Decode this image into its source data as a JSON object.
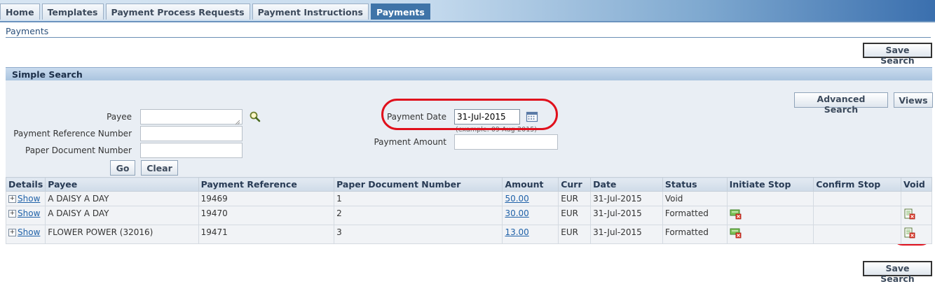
{
  "tabs": [
    {
      "label": "Home",
      "active": false
    },
    {
      "label": "Templates",
      "active": false
    },
    {
      "label": "Payment Process Requests",
      "active": false
    },
    {
      "label": "Payment Instructions",
      "active": false
    },
    {
      "label": "Payments",
      "active": true
    }
  ],
  "page": {
    "title": "Payments",
    "save_search_label": "Save Search"
  },
  "simple_search": {
    "section_title": "Simple Search",
    "advanced_search_label": "Advanced Search",
    "views_label": "Views",
    "payee_label": "Payee",
    "payee_value": "",
    "payment_reference_label": "Payment Reference Number",
    "payment_reference_value": "",
    "paper_document_label": "Paper Document Number",
    "paper_document_value": "",
    "payment_date_label": "Payment Date",
    "payment_date_value": "31-Jul-2015",
    "payment_date_hint": "(example: 09-Aug-2015)",
    "payment_amount_label": "Payment Amount",
    "payment_amount_value": "",
    "go_label": "Go",
    "clear_label": "Clear"
  },
  "results": {
    "headers": {
      "details": "Details",
      "payee": "Payee",
      "payment_reference": "Payment Reference",
      "paper_document": "Paper Document Number",
      "amount": "Amount",
      "currency": "Curr",
      "date": "Date",
      "status": "Status",
      "initiate_stop": "Initiate Stop",
      "confirm_stop": "Confirm Stop",
      "void": "Void"
    },
    "rows": [
      {
        "show": "Show",
        "payee": "A DAISY A DAY",
        "payment_reference": "19469",
        "paper_document": "1",
        "amount": "50.00",
        "currency": "EUR",
        "date": "31-Jul-2015",
        "status": "Void"
      },
      {
        "show": "Show",
        "payee": "A DAISY A DAY",
        "payment_reference": "19470",
        "paper_document": "2",
        "amount": "30.00",
        "currency": "EUR",
        "date": "31-Jul-2015",
        "status": "Formatted"
      },
      {
        "show": "Show",
        "payee": "FLOWER POWER (32016)",
        "payment_reference": "19471",
        "paper_document": "3",
        "amount": "13.00",
        "currency": "EUR",
        "date": "31-Jul-2015",
        "status": "Formatted"
      }
    ]
  },
  "icons": {
    "payee_lov": "search-icon",
    "payment_date_picker": "calendar-icon",
    "initiate_stop": "stop-payment-icon",
    "void": "void-payment-icon"
  },
  "colors": {
    "highlight": "#e0101c",
    "active_tab": "#3f74a8",
    "link": "#1f61a8"
  }
}
